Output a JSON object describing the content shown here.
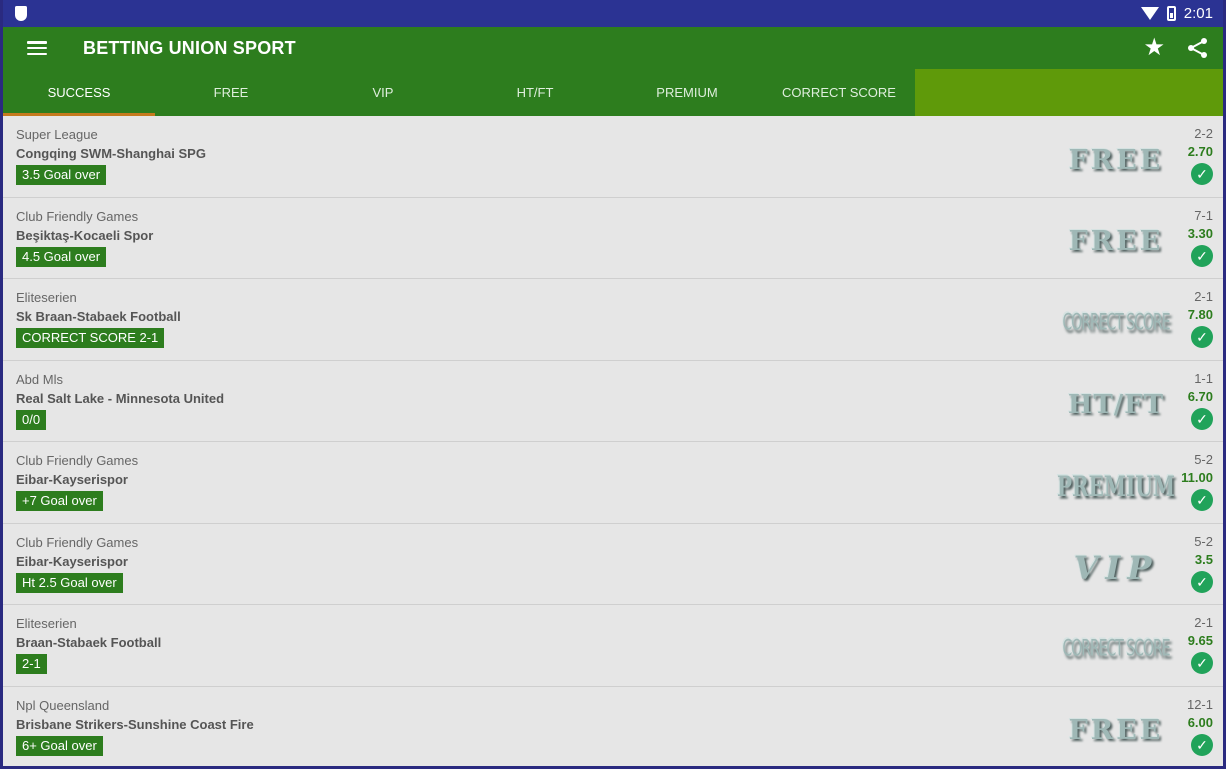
{
  "status_bar": {
    "time": "2:01"
  },
  "app": {
    "title": "BETTING UNION SPORT"
  },
  "tabs": [
    {
      "label": "SUCCESS",
      "active": true
    },
    {
      "label": "FREE"
    },
    {
      "label": "VIP"
    },
    {
      "label": "HT/FT"
    },
    {
      "label": "PREMIUM"
    },
    {
      "label": "CORRECT SCORE"
    }
  ],
  "items": [
    {
      "league": "Super League",
      "match": "Congqing SWM-Shanghai SPG",
      "pick": "3.5 Goal over",
      "badge": "FREE",
      "score": "2-2",
      "odds": "2.70"
    },
    {
      "league": "Club Friendly Games",
      "match": "Beşiktaş-Kocaeli Spor",
      "pick": "4.5 Goal over",
      "badge": "FREE",
      "score": "7-1",
      "odds": "3.30"
    },
    {
      "league": "Eliteserien",
      "match": "Sk Braan-Stabaek Football",
      "pick": "CORRECT SCORE 2-1",
      "badge": "CORRECT SCORE",
      "score": "2-1",
      "odds": "7.80"
    },
    {
      "league": "Abd Mls",
      "match": "Real Salt Lake - Minnesota United",
      "pick": "0/0",
      "badge": "HT/FT",
      "score": "1-1",
      "odds": "6.70"
    },
    {
      "league": "Club Friendly Games",
      "match": "Eibar-Kayserispor",
      "pick": "+7 Goal over",
      "badge": "PREMIUM",
      "score": "5-2",
      "odds": "11.00"
    },
    {
      "league": "Club Friendly Games",
      "match": "Eibar-Kayserispor",
      "pick": "Ht 2.5 Goal over",
      "badge": "VIP",
      "score": "5-2",
      "odds": "3.5"
    },
    {
      "league": "Eliteserien",
      "match": "Braan-Stabaek Football",
      "pick": "2-1",
      "badge": "CORRECT SCORE",
      "score": "2-1",
      "odds": "9.65"
    },
    {
      "league": "Npl Queensland",
      "match": "Brisbane Strikers-Sunshine Coast Fire",
      "pick": "6+ Goal over",
      "badge": "FREE",
      "score": "12-1",
      "odds": "6.00"
    }
  ],
  "colors": {
    "status_bar": "#2b3393",
    "app_bar": "#2d7d1e",
    "tab_filler": "#5f9a0a",
    "tab_indicator": "#c57a1e",
    "check": "#21a35a"
  },
  "icons": {
    "menu": "menu-icon",
    "star": "star-icon",
    "share": "share-icon",
    "check": "check-circle-icon"
  }
}
